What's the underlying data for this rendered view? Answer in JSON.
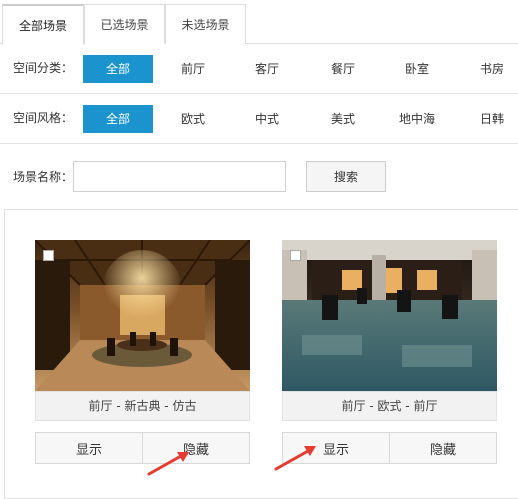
{
  "tabs": [
    {
      "label": "全部场景",
      "active": true
    },
    {
      "label": "已选场景",
      "active": false
    },
    {
      "label": "未选场景",
      "active": false
    }
  ],
  "filters": {
    "space_category": {
      "label": "空间分类：",
      "options": [
        "全部",
        "前厅",
        "客厅",
        "餐厅",
        "卧室",
        "书房"
      ],
      "selected": "全部"
    },
    "space_style": {
      "label": "空间风格：",
      "options": [
        "全部",
        "欧式",
        "中式",
        "美式",
        "地中海",
        "日韩"
      ],
      "selected": "全部"
    }
  },
  "search": {
    "label": "场景名称：",
    "value": "",
    "button_label": "搜索"
  },
  "scenes": [
    {
      "caption": "前厅 - 新古典 - 仿古",
      "show_label": "显示",
      "hide_label": "隐藏",
      "checked": false
    },
    {
      "caption": "前厅 - 欧式 - 前厅",
      "show_label": "显示",
      "hide_label": "隐藏",
      "checked": false
    }
  ],
  "colors": {
    "accent": "#1a93cf",
    "arrow": "#e63b2e"
  }
}
